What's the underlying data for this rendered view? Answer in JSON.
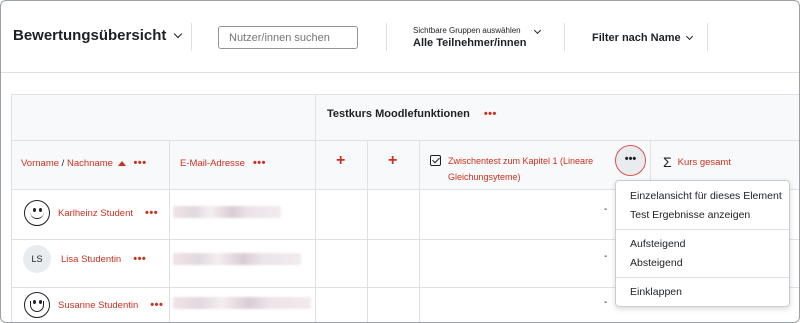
{
  "header": {
    "title": "Bewertungsübersicht",
    "search_placeholder": "Nutzer/innen suchen",
    "group_label": "Sichtbare Gruppen auswählen",
    "group_value": "Alle Teilnehmer/innen",
    "filter_label": "Filter nach Name"
  },
  "table": {
    "course_title": "Testkurs Moodlefunktionen",
    "columns": {
      "firstname": "Vorname",
      "separator": " / ",
      "lastname": "Nachname",
      "email": "E-Mail-Adresse",
      "grade_item": "Zwischentest zum Kapitel 1 (Lineare Gleichungsyteme)",
      "total": "Kurs gesamt"
    },
    "menu_dots": "•••",
    "plus": "+",
    "rows": [
      {
        "name": "Karlheinz Student",
        "avatar": "smile-icon",
        "grade": "-"
      },
      {
        "name": "Lisa Studentin",
        "avatar": "LS",
        "grade": "-"
      },
      {
        "name": "Susanne Studentin",
        "avatar": "grin-icon",
        "grade": "-"
      }
    ]
  },
  "dropdown": {
    "items": [
      "Einzelansicht für dieses Element",
      "Test Ergebnisse anzeigen",
      "Aufsteigend",
      "Absteigend",
      "Einklappen"
    ]
  },
  "colors": {
    "accent": "#ca3120",
    "border": "#dee2e6",
    "header_bg": "#f8f9fa"
  }
}
